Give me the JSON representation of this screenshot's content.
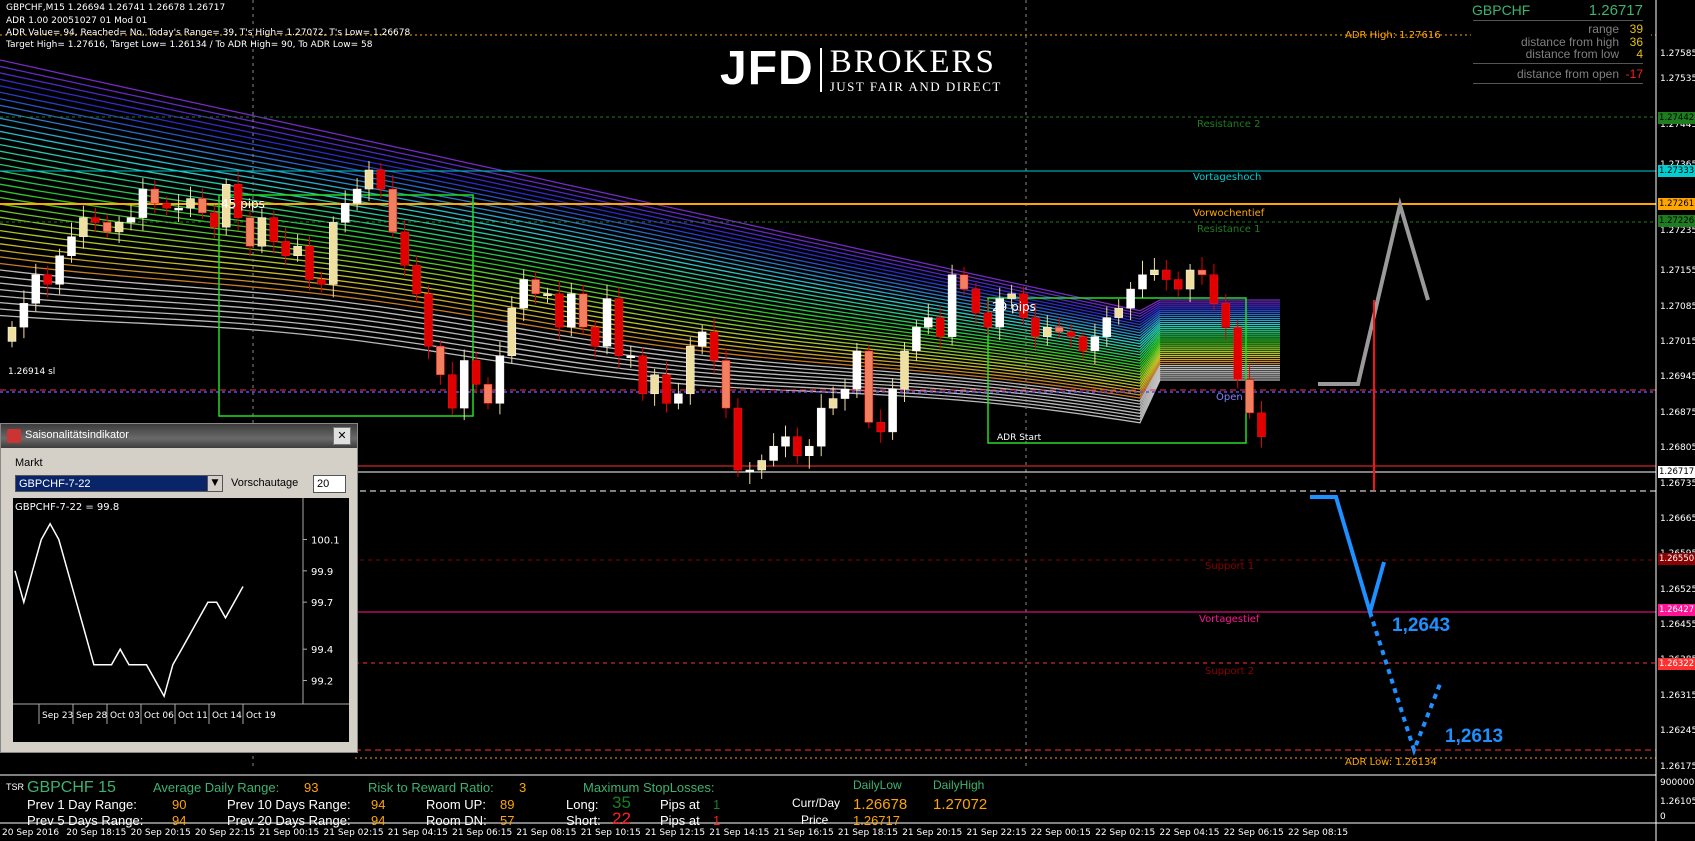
{
  "chart_data": {
    "type": "candlestick",
    "symbol": "GBPCHF",
    "timeframe": "M15",
    "ohlc_header": "GBPCHF,M15  1.26694 1.26741 1.26678 1.26717",
    "y_axis_labels": [
      "1.27585",
      "1.27535",
      "1.27445",
      "1.27365",
      "1.27235",
      "1.27155",
      "1.27085",
      "1.27015",
      "1.26945",
      "1.26875",
      "1.26805",
      "1.26735",
      "1.26665",
      "1.26595",
      "1.26525",
      "1.26455",
      "1.26385",
      "1.26315",
      "1.26245",
      "1.26175",
      "1.26105",
      "9000000",
      "0"
    ],
    "y_axis_values": [
      1.27585,
      1.27535,
      1.27445,
      1.27365,
      1.27235,
      1.27155,
      1.27085,
      1.27015,
      1.26945,
      1.26875,
      1.26805,
      1.26735,
      1.26665,
      1.26595,
      1.26525,
      1.26455,
      1.26385,
      1.26315,
      1.26245,
      1.26175,
      1.26105
    ],
    "x_tick_labels": [
      "20 Sep 2016",
      "20 Sep 18:15",
      "20 Sep 20:15",
      "20 Sep 22:15",
      "21 Sep 00:15",
      "21 Sep 02:15",
      "21 Sep 04:15",
      "21 Sep 06:15",
      "21 Sep 08:15",
      "21 Sep 10:15",
      "21 Sep 12:15",
      "21 Sep 14:15",
      "21 Sep 16:15",
      "21 Sep 18:15",
      "21 Sep 20:15",
      "21 Sep 22:15",
      "22 Sep 00:15",
      "22 Sep 02:15",
      "22 Sep 04:15",
      "22 Sep 06:15",
      "22 Sep 08:15"
    ],
    "closes": [
      1.269,
      1.2695,
      1.2701,
      1.2699,
      1.2705,
      1.2709,
      1.2713,
      1.2712,
      1.271,
      1.2712,
      1.2713,
      1.2719,
      1.2716,
      1.2715,
      1.2715,
      1.2717,
      1.2714,
      1.2711,
      1.272,
      1.2713,
      1.2707,
      1.2713,
      1.2708,
      1.2705,
      1.2707,
      1.27,
      1.2699,
      1.2712,
      1.2716,
      1.2719,
      1.2723,
      1.2719,
      1.271,
      1.2703,
      1.2697,
      1.2686,
      1.268,
      1.2673,
      1.2683,
      1.2678,
      1.2674,
      1.2684,
      1.2694,
      1.27,
      1.2697,
      1.2697,
      1.269,
      1.2697,
      1.269,
      1.2686,
      1.2696,
      1.2684,
      1.2684,
      1.2676,
      1.268,
      1.2674,
      1.2676,
      1.2686,
      1.2689,
      1.2683,
      1.2673,
      1.266,
      1.266,
      1.2662,
      1.2665,
      1.2667,
      1.2663,
      1.2665,
      1.2673,
      1.2675,
      1.2677,
      1.2685,
      1.267,
      1.2668,
      1.2677,
      1.2685,
      1.269,
      1.2692,
      1.2688,
      1.2701,
      1.2698,
      1.2693,
      1.269,
      1.2696,
      1.2697,
      1.2692,
      1.2688,
      1.269,
      1.2689,
      1.2688,
      1.2685,
      1.2688,
      1.2692,
      1.2694,
      1.2698,
      1.2701,
      1.2702,
      1.27,
      1.2698,
      1.2702,
      1.2701,
      1.2695,
      1.269,
      1.2679,
      1.2672,
      1.2667
    ],
    "resistance_support_levels": [
      {
        "name": "Resistance 2",
        "price": 1.27442,
        "color": "#1e7d1e"
      },
      {
        "name": "Vortageshoch",
        "price": 1.27333,
        "color": "#00ced1"
      },
      {
        "name": "Vorwochentief",
        "price": 1.27261,
        "color": "#ffa500"
      },
      {
        "name": "Resistance 1",
        "price": 1.27226,
        "color": "#1e7d1e"
      },
      {
        "name": "Support 1",
        "price": 1.2655,
        "color": "#8b0000"
      },
      {
        "name": "Vortagestief",
        "price": 1.26427,
        "color": "#ff1493"
      },
      {
        "name": "Support 2",
        "price": 1.26322,
        "color": "#8b0000"
      }
    ],
    "adr_high": "ADR High: 1.27616",
    "adr_low": "ADR Low: 1.26134",
    "target_1": "1,2643",
    "target_2": "1,2613",
    "current_price": "1.26717"
  },
  "header_lines": [
    "GBPCHF,M15  1.26694 1.26741 1.26678 1.26717",
    "ADR 1.00 20051027 01 Mod 01",
    "ADR Value= 94, Reached= No, Today's Range= 39, T's High= 1.27072, T's Low= 1.26678",
    "Target High= 1.27616, Target Low= 1.26134 / To ADR High= 90, To ADR Low= 58"
  ],
  "logo": {
    "main": "JFD",
    "brand": "BROKERS",
    "tagline": "JUST FAIR AND DIRECT"
  },
  "info_box": {
    "symbol": "GBPCHF",
    "price": "1.26717",
    "rows": [
      {
        "label": "range",
        "value": "39"
      },
      {
        "label": "distance from high",
        "value": "36"
      },
      {
        "label": "distance from low",
        "value": "4"
      },
      {
        "label": "distance from open",
        "value": "-17"
      }
    ]
  },
  "labels": {
    "pips_45": "45 pips",
    "pips_29": "29 pips",
    "adr_start": "ADR Start",
    "open": "Open",
    "left_marker": "1.26914 sl"
  },
  "price_boxes": [
    {
      "text": "1.27442",
      "color": "#1e7d1e"
    },
    {
      "text": "1.27333",
      "color": "#00ced1"
    },
    {
      "text": "1.27261",
      "color": "#ffa500"
    },
    {
      "text": "1.27226",
      "color": "#1e7d1e"
    },
    {
      "text": "1.26717",
      "color": "#ffffff"
    },
    {
      "text": "1.26550",
      "color": "#8b0000"
    },
    {
      "text": "1.26427",
      "color": "#ff1493"
    },
    {
      "text": "1.26322",
      "color": "#ff3030"
    }
  ],
  "seasonal_panel": {
    "title": "Saisonalitätsindikator",
    "market_label": "Markt",
    "market_value": "GBPCHF-7-22",
    "days_label": "Vorschautage",
    "days_value": "20",
    "plot_title": "GBPCHF-7-22 = 99.8",
    "y_ticks": [
      "100.1",
      "99.9",
      "99.7",
      "99.4",
      "99.2"
    ],
    "x_ticks": [
      "Sep 23",
      "Sep 28",
      "Oct 03",
      "Oct 06",
      "Oct 11",
      "Oct 14",
      "Oct 19"
    ],
    "values": [
      99.9,
      99.7,
      99.9,
      100.1,
      100.2,
      100.1,
      99.9,
      99.7,
      99.5,
      99.3,
      99.3,
      99.3,
      99.4,
      99.3,
      99.3,
      99.3,
      99.2,
      99.1,
      99.3,
      99.4,
      99.5,
      99.6,
      99.7,
      99.7,
      99.6,
      99.7,
      99.8
    ]
  },
  "bottom_panel": {
    "tsr": "TSR",
    "symbol": "GBPCHF  15",
    "adr_label": "Average Daily Range:",
    "adr_value": "93",
    "rr_label": "Risk to Reward Ratio:",
    "rr_value": "3",
    "max_sl_label": "Maximum StopLosses:",
    "prev1_label": "Prev 1 Day Range:",
    "prev1_value": "90",
    "prev10_label": "Prev 10 Days Range:",
    "prev10_value": "94",
    "room_up_label": "Room UP:",
    "room_up_value": "89",
    "long_label": "Long:",
    "long_value": "35",
    "pips_at_1": "Pips at",
    "pips_at_1_val": "1",
    "prev5_label": "Prev 5 Days Range:",
    "prev5_value": "94",
    "prev20_label": "Prev 20 Days Range:",
    "prev20_value": "94",
    "room_dn_label": "Room DN:",
    "room_dn_value": "57",
    "short_label": "Short:",
    "short_value": "22",
    "pips_at_2": "Pips at",
    "pips_at_2_val": "1",
    "curr_day_label": "Curr/Day",
    "price_label": "Price",
    "price_value": "1.26717",
    "daily_low_label": "DailyLow",
    "daily_low_value": "1.26678",
    "daily_high_label": "DailyHigh",
    "daily_high_value": "1.27072"
  }
}
